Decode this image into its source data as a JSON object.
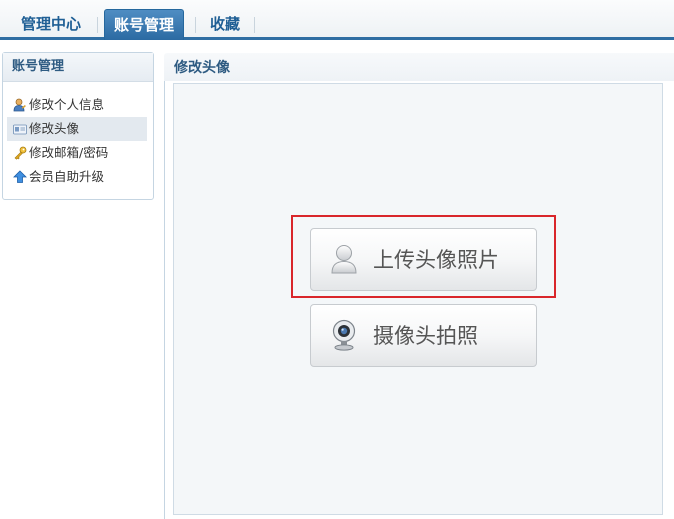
{
  "tabs": [
    {
      "label": "管理中心",
      "active": false
    },
    {
      "label": "账号管理",
      "active": true
    },
    {
      "label": "收藏",
      "active": false
    }
  ],
  "sidebar": {
    "title": "账号管理",
    "items": [
      {
        "label": "修改个人信息",
        "icon": "user-edit-icon",
        "active": false
      },
      {
        "label": "修改头像",
        "icon": "id-card-icon",
        "active": true
      },
      {
        "label": "修改邮箱/密码",
        "icon": "key-icon",
        "active": false
      },
      {
        "label": "会员自助升级",
        "icon": "upgrade-arrow-icon",
        "active": false
      }
    ]
  },
  "main": {
    "title": "修改头像",
    "upload_button": {
      "label": "上传头像照片",
      "icon": "user-silhouette-icon"
    },
    "camera_button": {
      "label": "摄像头拍照",
      "icon": "webcam-icon"
    }
  },
  "colors": {
    "accent": "#2f6ea3",
    "highlight": "#d9262b"
  }
}
